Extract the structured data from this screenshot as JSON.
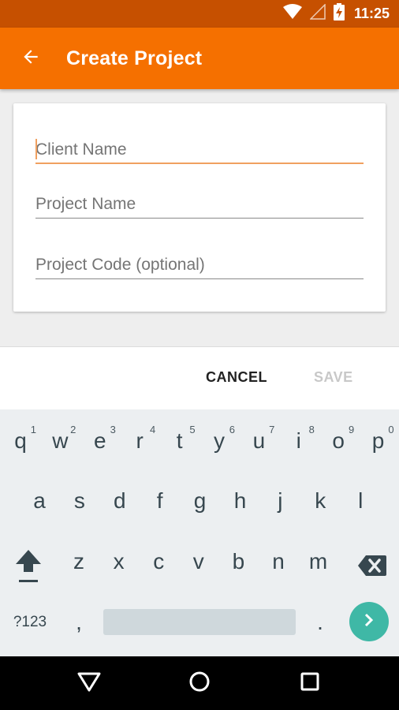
{
  "status_bar": {
    "time": "11:25",
    "icons": [
      "wifi-icon",
      "signal-icon",
      "battery-charging-icon"
    ]
  },
  "app_bar": {
    "back_icon": "arrow-back-icon",
    "title": "Create Project",
    "color": "#f57000",
    "status_color": "#c65000"
  },
  "form": {
    "client_name": {
      "value": "",
      "placeholder": "Client Name",
      "focused": true
    },
    "project_name": {
      "value": "",
      "placeholder": "Project Name"
    },
    "project_code": {
      "value": "",
      "placeholder": "Project Code (optional)"
    },
    "accent_color": "#f0a060"
  },
  "actions": {
    "cancel": "CANCEL",
    "save": "SAVE",
    "save_enabled": false
  },
  "keyboard": {
    "row1": [
      {
        "k": "q",
        "h": "1"
      },
      {
        "k": "w",
        "h": "2"
      },
      {
        "k": "e",
        "h": "3"
      },
      {
        "k": "r",
        "h": "4"
      },
      {
        "k": "t",
        "h": "5"
      },
      {
        "k": "y",
        "h": "6"
      },
      {
        "k": "u",
        "h": "7"
      },
      {
        "k": "i",
        "h": "8"
      },
      {
        "k": "o",
        "h": "9"
      },
      {
        "k": "p",
        "h": "0"
      }
    ],
    "row2": [
      "a",
      "s",
      "d",
      "f",
      "g",
      "h",
      "j",
      "k",
      "l"
    ],
    "row3": [
      "z",
      "x",
      "c",
      "v",
      "b",
      "n",
      "m"
    ],
    "symbols": "?123",
    "comma": ",",
    "period": ".",
    "shift_icon": "shift-icon",
    "backspace_icon": "backspace-icon",
    "enter_icon": "chevron-right-icon",
    "enter_color": "#3fb8a6"
  },
  "nav_bar": {
    "icons": [
      "back-triangle-icon",
      "home-circle-icon",
      "recents-square-icon"
    ]
  }
}
